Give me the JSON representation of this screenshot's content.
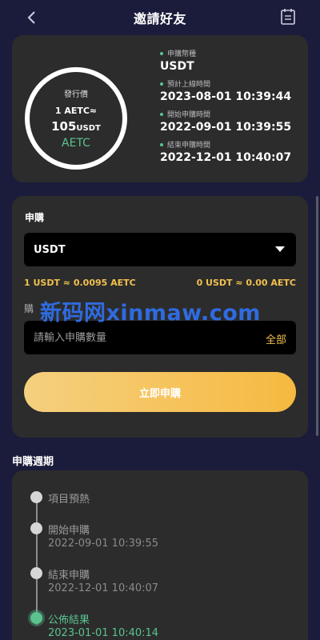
{
  "header": {
    "title": "邀請好友",
    "back_icon": "chevron-left-icon",
    "records_icon": "clipboard-icon"
  },
  "issue": {
    "price_label": "發行價",
    "rate": "1 AETC≈",
    "price_value": "105",
    "price_unit": "USDT",
    "coin": "AETC"
  },
  "info": [
    {
      "label": "申購幣種",
      "value": "USDT"
    },
    {
      "label": "預計上線時間",
      "value": "2023-08-01 10:39:44"
    },
    {
      "label": "開始申購時間",
      "value": "2022-09-01 10:39:55"
    },
    {
      "label": "結束申購時間",
      "value": "2022-12-01 10:40:07"
    }
  ],
  "subscribe": {
    "title": "申購",
    "selected_currency": "USDT",
    "rate_left": "1 USDT ≈ 0.0095 AETC",
    "rate_right": "0 USDT ≈ 0.00 AETC",
    "amount_label": "購",
    "amount_placeholder": "請輸入申購數量",
    "all_label": "全部",
    "button_label": "立即申購"
  },
  "watermark": "新码网xinmaw.com",
  "period": {
    "title": "申購週期",
    "steps": [
      {
        "name": "項目預熱",
        "time": ""
      },
      {
        "name": "開始申購",
        "time": "2022-09-01 10:39:55"
      },
      {
        "name": "結束申購",
        "time": "2022-12-01 10:40:07"
      },
      {
        "name": "公佈結果",
        "time": "2023-01-01 10:40:14"
      }
    ]
  },
  "colors": {
    "background": "#1b1c3b",
    "card": "#2c2c2c",
    "accent_green": "#5ac38f",
    "accent_gold": "#f2c04f"
  }
}
